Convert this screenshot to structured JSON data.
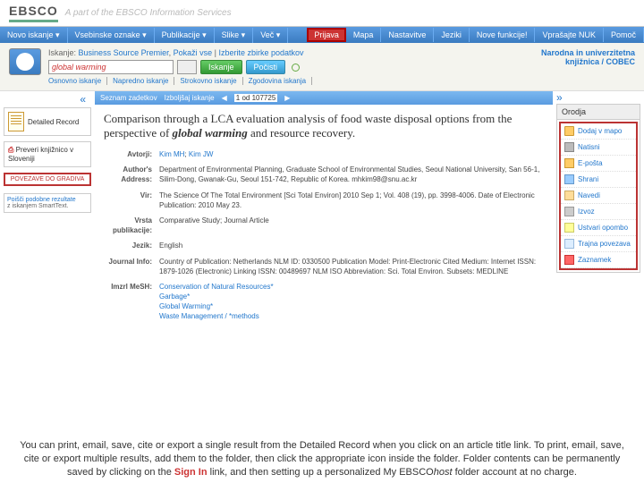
{
  "logo": {
    "brand": "EBSCO",
    "tagline": "A part of the EBSCO Information Services"
  },
  "nav": {
    "left": [
      "Novo iskanje",
      "Vsebinske oznake",
      "Publikacije",
      "Slike",
      "Več"
    ],
    "right": [
      "Prijava",
      "Mapa",
      "Nastavitve",
      "Jeziki",
      "Nove funkcije!",
      "Vprašajte NUK",
      "Pomoč"
    ]
  },
  "search": {
    "src_label": "Iskanje:",
    "src_db": "Business Source Premier",
    "src_show": "Pokaži vse",
    "src_choose": "Izberite zbirke podatkov",
    "value": "global warming",
    "btn_search": "Iskanje",
    "btn_clear": "Počisti",
    "sublinks": [
      "Osnovno iskanje",
      "Napredno iskanje",
      "Strokovno iskanje",
      "Zgodovina iskanja"
    ]
  },
  "library": "Narodna in univerzitetna knjižnica / COBEC",
  "left": {
    "detailed": "Detailed Record",
    "check_lib": "Preveri knjižnico v Sloveniji",
    "linked": "POVEZAVE DO GRADIVA",
    "similar_hdr": "Poišči podobne rezultate",
    "similar_txt": "z iskanjem SmartText."
  },
  "midbar": {
    "sort_label": "Seznam zadetkov",
    "refine_label": "Izboljšaj iskanje",
    "page": "1 od 107725"
  },
  "article": {
    "title_pre": "Comparison through a LCA evaluation analysis of food waste disposal options from the perspective of ",
    "title_kw": "global warming",
    "title_post": " and resource recovery.",
    "labels": {
      "authors": "Avtorji:",
      "author_addr": "Author's Address:",
      "source": "Vir:",
      "pubtype": "Vrsta publikacije:",
      "lang": "Jezik:",
      "journal": "Journal Info:",
      "mesh": "Imzrl MeSH:"
    },
    "authors": [
      "Kim MH",
      "Kim JW"
    ],
    "addr": "Department of Environmental Planning, Graduate School of Environmental Studies, Seoul National University, San 56-1, Silim-Dong, Gwanak-Gu, Seoul 151-742, Republic of Korea. mhkim98@snu.ac.kr",
    "source": "The Science Of The Total Environment [Sci Total Environ] 2010 Sep 1; Vol. 408 (19), pp. 3998-4006. Date of Electronic Publication: 2010 May 23.",
    "pubtype": "Comparative Study; Journal Article",
    "lang": "English",
    "journal": "Country of Publication: Netherlands NLM ID: 0330500 Publication Model: Print-Electronic Cited Medium: Internet ISSN: 1879-1026 (Electronic) Linking ISSN: 00489697 NLM ISO Abbreviation: Sci. Total Environ. Subsets: MEDLINE",
    "mesh": [
      "Conservation of Natural Resources*",
      "Garbage*",
      "Global Warming*",
      "Waste Management / *methods"
    ]
  },
  "tools": {
    "hdr": "Orodja",
    "items": [
      {
        "ic": "folder",
        "label": "Dodaj v mapo"
      },
      {
        "ic": "print",
        "label": "Natisni"
      },
      {
        "ic": "mail",
        "label": "E-pošta"
      },
      {
        "ic": "save",
        "label": "Shrani"
      },
      {
        "ic": "cite",
        "label": "Navedi"
      },
      {
        "ic": "export",
        "label": "Izvoz"
      },
      {
        "ic": "note",
        "label": "Ustvari opombo"
      },
      {
        "ic": "link",
        "label": "Trajna povezava"
      },
      {
        "ic": "bm",
        "label": "Zaznamek"
      }
    ]
  },
  "caption": {
    "line1": "You can print, email, save, cite or export a single result from the Detailed Record when you click on an article title link. To print, email, save, cite or export multiple results, add them to the folder, then click the appropriate icon inside the folder. Folder contents can be permanently saved by clicking on the ",
    "signin": "Sign In",
    "line2": " link, and then setting up a personalized My EBSCO",
    "host": "host",
    "line3": " folder account at no charge."
  }
}
